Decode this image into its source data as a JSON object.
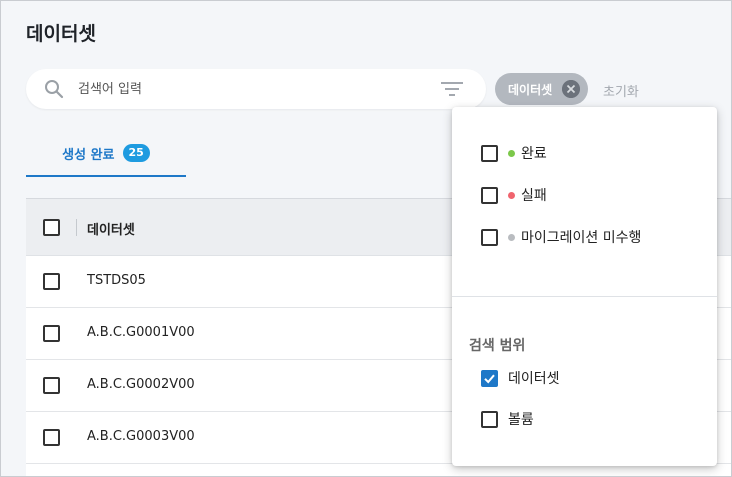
{
  "page": {
    "title": "데이터셋"
  },
  "search": {
    "placeholder": "검색어 입력",
    "value": ""
  },
  "filter_chip": {
    "label": "데이터셋"
  },
  "reset": {
    "label": "초기화"
  },
  "tab": {
    "label": "생성 완료",
    "count": "25"
  },
  "table": {
    "header": "데이터셋",
    "rows": [
      "TSTDS05",
      "A.B.C.G0001V00",
      "A.B.C.G0002V00",
      "A.B.C.G0003V00"
    ]
  },
  "dropdown": {
    "status_options": [
      {
        "label": "완료",
        "dot_color": "#7cc84a",
        "checked": false
      },
      {
        "label": "실패",
        "dot_color": "#f0646e",
        "checked": false
      },
      {
        "label": "마이그레이션 미수행",
        "dot_color": "#b9bcc0",
        "checked": false
      }
    ],
    "scope_title": "검색 범위",
    "scope_options": [
      {
        "label": "데이터셋",
        "checked": true
      },
      {
        "label": "볼륨",
        "checked": false
      }
    ]
  },
  "colors": {
    "accent": "#1e78c8",
    "badge": "#1e9be0",
    "chip": "#b3b8bf"
  }
}
